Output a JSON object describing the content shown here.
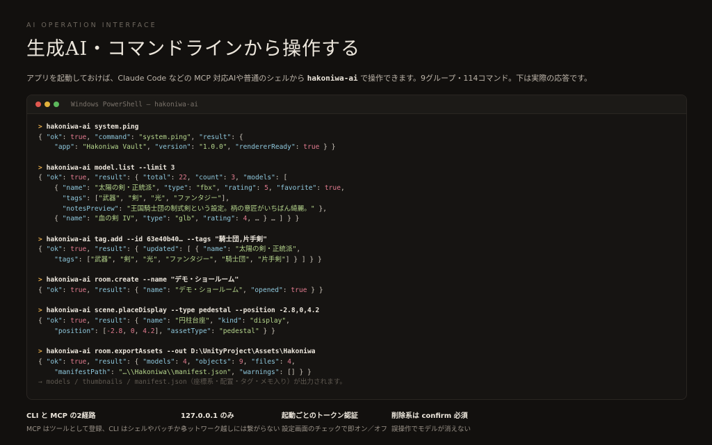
{
  "header": {
    "eyebrow": "AI OPERATION INTERFACE",
    "title": "生成AI・コマンドラインから操作する",
    "lead_before": "アプリを起動しておけば、Claude Code などの MCP 対応AIや普通のシェルから ",
    "lead_cmd": "hakoniwa-ai",
    "lead_after": " で操作できます。9グループ・114コマンド。下は実際の応答です。"
  },
  "terminal": {
    "window_title": "Windows PowerShell — hakoniwa-ai",
    "prompt": ">",
    "blocks": [
      {
        "command": "hakoniwa-ai system.ping",
        "lines": [
          [
            [
              "p",
              "{ "
            ],
            [
              "k",
              "\"ok\""
            ],
            [
              "p",
              ": "
            ],
            [
              "b",
              "true"
            ],
            [
              "p",
              ", "
            ],
            [
              "k",
              "\"command\""
            ],
            [
              "p",
              ": "
            ],
            [
              "s",
              "\"system.ping\""
            ],
            [
              "p",
              ", "
            ],
            [
              "k",
              "\"result\""
            ],
            [
              "p",
              ": {"
            ]
          ],
          [
            [
              "p",
              "    "
            ],
            [
              "k",
              "\"app\""
            ],
            [
              "p",
              ": "
            ],
            [
              "s",
              "\"Hakoniwa Vault\""
            ],
            [
              "p",
              ", "
            ],
            [
              "k",
              "\"version\""
            ],
            [
              "p",
              ": "
            ],
            [
              "s",
              "\"1.0.0\""
            ],
            [
              "p",
              ", "
            ],
            [
              "k",
              "\"rendererReady\""
            ],
            [
              "p",
              ": "
            ],
            [
              "b",
              "true"
            ],
            [
              "p",
              " } }"
            ]
          ]
        ]
      },
      {
        "command": "hakoniwa-ai model.list --limit 3",
        "lines": [
          [
            [
              "p",
              "{ "
            ],
            [
              "k",
              "\"ok\""
            ],
            [
              "p",
              ": "
            ],
            [
              "b",
              "true"
            ],
            [
              "p",
              ", "
            ],
            [
              "k",
              "\"result\""
            ],
            [
              "p",
              ": { "
            ],
            [
              "k",
              "\"total\""
            ],
            [
              "p",
              ": "
            ],
            [
              "n",
              "22"
            ],
            [
              "p",
              ", "
            ],
            [
              "k",
              "\"count\""
            ],
            [
              "p",
              ": "
            ],
            [
              "n",
              "3"
            ],
            [
              "p",
              ", "
            ],
            [
              "k",
              "\"models\""
            ],
            [
              "p",
              ": ["
            ]
          ],
          [
            [
              "p",
              "    { "
            ],
            [
              "k",
              "\"name\""
            ],
            [
              "p",
              ": "
            ],
            [
              "s",
              "\"太陽の剣・正統派\""
            ],
            [
              "p",
              ", "
            ],
            [
              "k",
              "\"type\""
            ],
            [
              "p",
              ": "
            ],
            [
              "s",
              "\"fbx\""
            ],
            [
              "p",
              ", "
            ],
            [
              "k",
              "\"rating\""
            ],
            [
              "p",
              ": "
            ],
            [
              "n",
              "5"
            ],
            [
              "p",
              ", "
            ],
            [
              "k",
              "\"favorite\""
            ],
            [
              "p",
              ": "
            ],
            [
              "b",
              "true"
            ],
            [
              "p",
              ","
            ]
          ],
          [
            [
              "p",
              "      "
            ],
            [
              "k",
              "\"tags\""
            ],
            [
              "p",
              ": ["
            ],
            [
              "s",
              "\"武器\""
            ],
            [
              "p",
              ", "
            ],
            [
              "s",
              "\"剣\""
            ],
            [
              "p",
              ", "
            ],
            [
              "s",
              "\"光\""
            ],
            [
              "p",
              ", "
            ],
            [
              "s",
              "\"ファンタジー\""
            ],
            [
              "p",
              "],"
            ]
          ],
          [
            [
              "p",
              "      "
            ],
            [
              "k",
              "\"notesPreview\""
            ],
            [
              "p",
              ": "
            ],
            [
              "s",
              "\"王国騎士団の制式剣という設定。柄の意匠がいちばん綺麗。\""
            ],
            [
              "p",
              " },"
            ]
          ],
          [
            [
              "p",
              "    { "
            ],
            [
              "k",
              "\"name\""
            ],
            [
              "p",
              ": "
            ],
            [
              "s",
              "\"血の剣 IV\""
            ],
            [
              "p",
              ", "
            ],
            [
              "k",
              "\"type\""
            ],
            [
              "p",
              ": "
            ],
            [
              "s",
              "\"glb\""
            ],
            [
              "p",
              ", "
            ],
            [
              "k",
              "\"rating\""
            ],
            [
              "p",
              ": "
            ],
            [
              "n",
              "4"
            ],
            [
              "p",
              ", … } … ] } }"
            ]
          ]
        ]
      },
      {
        "command": "hakoniwa-ai tag.add --id 63e40b40… --tags \"騎士団,片手剣\"",
        "lines": [
          [
            [
              "p",
              "{ "
            ],
            [
              "k",
              "\"ok\""
            ],
            [
              "p",
              ": "
            ],
            [
              "b",
              "true"
            ],
            [
              "p",
              ", "
            ],
            [
              "k",
              "\"result\""
            ],
            [
              "p",
              ": { "
            ],
            [
              "k",
              "\"updated\""
            ],
            [
              "p",
              ": [ { "
            ],
            [
              "k",
              "\"name\""
            ],
            [
              "p",
              ": "
            ],
            [
              "s",
              "\"太陽の剣・正統派\""
            ],
            [
              "p",
              ","
            ]
          ],
          [
            [
              "p",
              "    "
            ],
            [
              "k",
              "\"tags\""
            ],
            [
              "p",
              ": ["
            ],
            [
              "s",
              "\"武器\""
            ],
            [
              "p",
              ", "
            ],
            [
              "s",
              "\"剣\""
            ],
            [
              "p",
              ", "
            ],
            [
              "s",
              "\"光\""
            ],
            [
              "p",
              ", "
            ],
            [
              "s",
              "\"ファンタジー\""
            ],
            [
              "p",
              ", "
            ],
            [
              "s",
              "\"騎士団\""
            ],
            [
              "p",
              ", "
            ],
            [
              "s",
              "\"片手剣\""
            ],
            [
              "p",
              "] } ] } }"
            ]
          ]
        ]
      },
      {
        "command": "hakoniwa-ai room.create --name \"デモ・ショールーム\"",
        "lines": [
          [
            [
              "p",
              "{ "
            ],
            [
              "k",
              "\"ok\""
            ],
            [
              "p",
              ": "
            ],
            [
              "b",
              "true"
            ],
            [
              "p",
              ", "
            ],
            [
              "k",
              "\"result\""
            ],
            [
              "p",
              ": { "
            ],
            [
              "k",
              "\"name\""
            ],
            [
              "p",
              ": "
            ],
            [
              "s",
              "\"デモ・ショールーム\""
            ],
            [
              "p",
              ", "
            ],
            [
              "k",
              "\"opened\""
            ],
            [
              "p",
              ": "
            ],
            [
              "b",
              "true"
            ],
            [
              "p",
              " } }"
            ]
          ]
        ]
      },
      {
        "command": "hakoniwa-ai scene.placeDisplay --type pedestal --position -2.8,0,4.2",
        "lines": [
          [
            [
              "p",
              "{ "
            ],
            [
              "k",
              "\"ok\""
            ],
            [
              "p",
              ": "
            ],
            [
              "b",
              "true"
            ],
            [
              "p",
              ", "
            ],
            [
              "k",
              "\"result\""
            ],
            [
              "p",
              ": { "
            ],
            [
              "k",
              "\"name\""
            ],
            [
              "p",
              ": "
            ],
            [
              "s",
              "\"円柱台座\""
            ],
            [
              "p",
              ", "
            ],
            [
              "k",
              "\"kind\""
            ],
            [
              "p",
              ": "
            ],
            [
              "s",
              "\"display\""
            ],
            [
              "p",
              ","
            ]
          ],
          [
            [
              "p",
              "    "
            ],
            [
              "k",
              "\"position\""
            ],
            [
              "p",
              ": ["
            ],
            [
              "n",
              "-2.8"
            ],
            [
              "p",
              ", "
            ],
            [
              "n",
              "0"
            ],
            [
              "p",
              ", "
            ],
            [
              "n",
              "4.2"
            ],
            [
              "p",
              "], "
            ],
            [
              "k",
              "\"assetType\""
            ],
            [
              "p",
              ": "
            ],
            [
              "s",
              "\"pedestal\""
            ],
            [
              "p",
              " } }"
            ]
          ]
        ]
      },
      {
        "command": "hakoniwa-ai room.exportAssets --out D:\\UnityProject\\Assets\\Hakoniwa",
        "lines": [
          [
            [
              "p",
              "{ "
            ],
            [
              "k",
              "\"ok\""
            ],
            [
              "p",
              ": "
            ],
            [
              "b",
              "true"
            ],
            [
              "p",
              ", "
            ],
            [
              "k",
              "\"result\""
            ],
            [
              "p",
              ": { "
            ],
            [
              "k",
              "\"models\""
            ],
            [
              "p",
              ": "
            ],
            [
              "n",
              "4"
            ],
            [
              "p",
              ", "
            ],
            [
              "k",
              "\"objects\""
            ],
            [
              "p",
              ": "
            ],
            [
              "n",
              "9"
            ],
            [
              "p",
              ", "
            ],
            [
              "k",
              "\"files\""
            ],
            [
              "p",
              ": "
            ],
            [
              "n",
              "4"
            ],
            [
              "p",
              ","
            ]
          ],
          [
            [
              "p",
              "    "
            ],
            [
              "k",
              "\"manifestPath\""
            ],
            [
              "p",
              ": "
            ],
            [
              "s",
              "\"…\\\\Hakoniwa\\\\manifest.json\""
            ],
            [
              "p",
              ", "
            ],
            [
              "k",
              "\"warnings\""
            ],
            [
              "p",
              ": [] } }"
            ]
          ],
          [
            [
              "note",
              "→ models / thumbnails / manifest.json（座標系・配置・タグ・メモ入り）が出力されます。"
            ]
          ]
        ]
      }
    ]
  },
  "features": [
    {
      "title": "CLI と MCP の2経路",
      "desc": "MCP はツールとして登録、CLI はシェルやバッチから"
    },
    {
      "title": "127.0.0.1 のみ",
      "desc": "ネットワーク越しには繋がらない"
    },
    {
      "title": "起動ごとのトークン認証",
      "desc": "設定画面のチェックで即オン／オフ"
    },
    {
      "title": "削除系は confirm 必須",
      "desc": "誤操作でモデルが消えない"
    }
  ],
  "colors": {
    "background": "#12100e",
    "prompt": "#e0a84a",
    "key": "#8ec7dc",
    "string": "#b5d58c",
    "number": "#e07a8e"
  }
}
